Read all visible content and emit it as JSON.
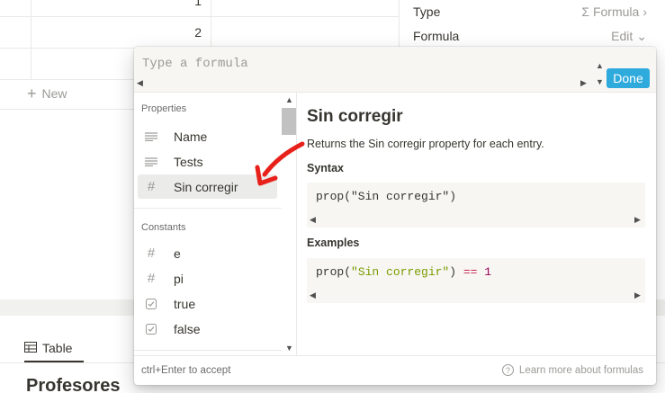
{
  "background": {
    "rows": [
      {
        "num": "1"
      },
      {
        "num": "2"
      },
      {
        "num": ""
      }
    ],
    "new_label": "New",
    "view_tab": "Table",
    "page_title": "Profesores",
    "props": {
      "type_label": "Type",
      "type_value": "Formula",
      "formula_label": "Formula",
      "formula_value": "Edit"
    }
  },
  "popup": {
    "input_placeholder": "Type a formula",
    "done_label": "Done",
    "properties_label": "Properties",
    "properties": [
      {
        "label": "Name",
        "icon": "text-lines-icon"
      },
      {
        "label": "Tests",
        "icon": "text-lines-icon"
      },
      {
        "label": "Sin corregir",
        "icon": "number-hash-icon"
      }
    ],
    "constants_label": "Constants",
    "constants": [
      {
        "label": "e",
        "icon": "number-hash-icon"
      },
      {
        "label": "pi",
        "icon": "number-hash-icon"
      },
      {
        "label": "true",
        "icon": "checkbox-icon"
      },
      {
        "label": "false",
        "icon": "checkbox-icon"
      }
    ],
    "doc": {
      "title": "Sin corregir",
      "description": "Returns the Sin corregir property for each entry.",
      "syntax_heading": "Syntax",
      "syntax_code": "prop(\"Sin corregir\")",
      "examples_heading": "Examples",
      "example_prefix": "prop(",
      "example_string": "\"Sin corregir\"",
      "example_close": ")",
      "example_op": "==",
      "example_num": "1"
    },
    "footer_hint": "ctrl+Enter to accept",
    "footer_learn": "Learn more about formulas"
  },
  "colors": {
    "accent": "#2eaadc",
    "annotation_arrow": "#e8201a"
  }
}
